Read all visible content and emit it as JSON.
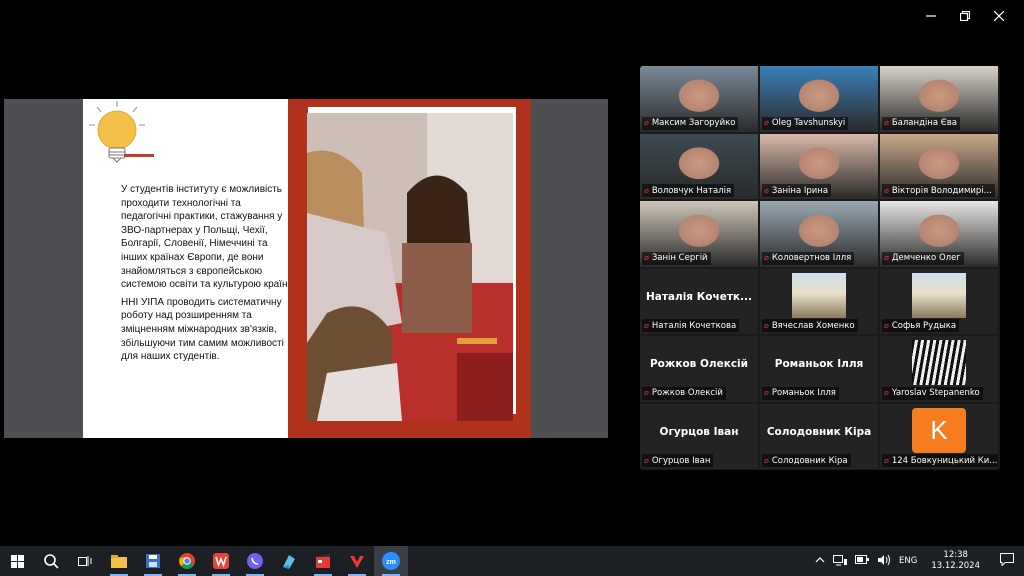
{
  "window": {
    "minimize_icon": "minimize-icon",
    "restore_icon": "restore-icon",
    "close_icon": "close-icon"
  },
  "slide": {
    "paragraph1": "У студентів інституту є можливість проходити технологічні та педагогічні практики, стажування у ЗВО-партнерах у Польщі, Чехії, Болгарії, Словенії, Німеччині та інших країнах Європи, де вони знайомляться з європейською системою освіти та культурою країн.",
    "paragraph2": "ННІ УІПА проводить систематичну роботу над розширенням та зміцненням міжнародних зв'язків, збільшуючи тим самим можливості для наших студентів.",
    "accent_color": "#b0321d"
  },
  "participants": [
    {
      "name": "Максим Загоруйко",
      "muted": true,
      "video": true
    },
    {
      "name": "Oleg Tavshunskyi",
      "muted": true,
      "video": true
    },
    {
      "name": "Баландіна Єва",
      "muted": true,
      "video": true
    },
    {
      "name": "Воловчук Наталія",
      "muted": true,
      "video": true,
      "active": true
    },
    {
      "name": "Заніна Ірина",
      "muted": true,
      "video": true
    },
    {
      "name": "Вікторія Володимирі...",
      "muted": true,
      "video": true
    },
    {
      "name": "Занін Сергій",
      "muted": true,
      "video": true
    },
    {
      "name": "Коловертнов Ілля",
      "muted": true,
      "video": true
    },
    {
      "name": "Демченко Олег",
      "muted": true,
      "video": true
    },
    {
      "name": "Наталія Кочеткова",
      "display": "Наталія Кочетк...",
      "muted": true,
      "video": false
    },
    {
      "name": "Вячеслав Хоменко",
      "muted": true,
      "video": false,
      "avatar": "photo"
    },
    {
      "name": "Софья Рудыка",
      "muted": true,
      "video": false,
      "avatar": "photo"
    },
    {
      "name": "Рожков Олексій",
      "display": "Рожков Олексій",
      "muted": true,
      "video": false
    },
    {
      "name": "Романьок Ілля",
      "display": "Романьок Ілля",
      "muted": true,
      "video": false
    },
    {
      "name": "Yaroslav Stepanenko",
      "muted": true,
      "video": false,
      "avatar": "manga"
    },
    {
      "name": "Огурцов Іван",
      "display": "Огурцов Іван",
      "muted": true,
      "video": false
    },
    {
      "name": "Солодовник Кіра",
      "display": "Солодовник Кіра",
      "muted": true,
      "video": false
    },
    {
      "name": "124 Бовкуницький Ки...",
      "muted": true,
      "video": false,
      "avatar": "letter",
      "letter": "K"
    }
  ],
  "taskbar": {
    "apps": [
      "windows-start-icon",
      "search-icon",
      "task-view-icon",
      "file-explorer-icon",
      "save-icon",
      "chrome-icon",
      "wps-office-icon",
      "viber-icon",
      "notepad-icon",
      "video-editor-icon",
      "vivaldi-icon",
      "zoom-icon"
    ],
    "language": "ENG",
    "time": "12:38",
    "date": "13.12.2024"
  }
}
